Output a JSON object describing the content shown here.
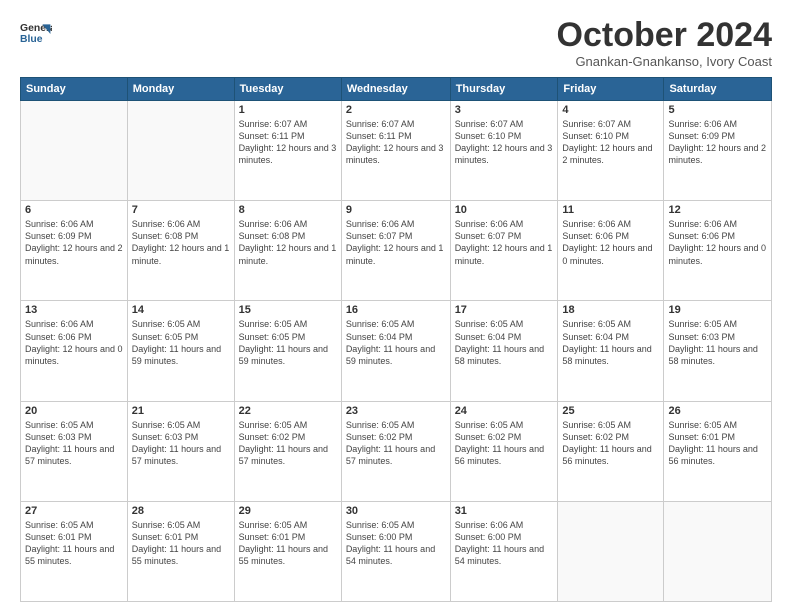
{
  "logo": {
    "line1": "General",
    "line2": "Blue"
  },
  "title": "October 2024",
  "subtitle": "Gnankan-Gnankanso, Ivory Coast",
  "weekdays": [
    "Sunday",
    "Monday",
    "Tuesday",
    "Wednesday",
    "Thursday",
    "Friday",
    "Saturday"
  ],
  "weeks": [
    [
      {
        "day": "",
        "info": ""
      },
      {
        "day": "",
        "info": ""
      },
      {
        "day": "1",
        "info": "Sunrise: 6:07 AM\nSunset: 6:11 PM\nDaylight: 12 hours and 3 minutes."
      },
      {
        "day": "2",
        "info": "Sunrise: 6:07 AM\nSunset: 6:11 PM\nDaylight: 12 hours and 3 minutes."
      },
      {
        "day": "3",
        "info": "Sunrise: 6:07 AM\nSunset: 6:10 PM\nDaylight: 12 hours and 3 minutes."
      },
      {
        "day": "4",
        "info": "Sunrise: 6:07 AM\nSunset: 6:10 PM\nDaylight: 12 hours and 2 minutes."
      },
      {
        "day": "5",
        "info": "Sunrise: 6:06 AM\nSunset: 6:09 PM\nDaylight: 12 hours and 2 minutes."
      }
    ],
    [
      {
        "day": "6",
        "info": "Sunrise: 6:06 AM\nSunset: 6:09 PM\nDaylight: 12 hours and 2 minutes."
      },
      {
        "day": "7",
        "info": "Sunrise: 6:06 AM\nSunset: 6:08 PM\nDaylight: 12 hours and 1 minute."
      },
      {
        "day": "8",
        "info": "Sunrise: 6:06 AM\nSunset: 6:08 PM\nDaylight: 12 hours and 1 minute."
      },
      {
        "day": "9",
        "info": "Sunrise: 6:06 AM\nSunset: 6:07 PM\nDaylight: 12 hours and 1 minute."
      },
      {
        "day": "10",
        "info": "Sunrise: 6:06 AM\nSunset: 6:07 PM\nDaylight: 12 hours and 1 minute."
      },
      {
        "day": "11",
        "info": "Sunrise: 6:06 AM\nSunset: 6:06 PM\nDaylight: 12 hours and 0 minutes."
      },
      {
        "day": "12",
        "info": "Sunrise: 6:06 AM\nSunset: 6:06 PM\nDaylight: 12 hours and 0 minutes."
      }
    ],
    [
      {
        "day": "13",
        "info": "Sunrise: 6:06 AM\nSunset: 6:06 PM\nDaylight: 12 hours and 0 minutes."
      },
      {
        "day": "14",
        "info": "Sunrise: 6:05 AM\nSunset: 6:05 PM\nDaylight: 11 hours and 59 minutes."
      },
      {
        "day": "15",
        "info": "Sunrise: 6:05 AM\nSunset: 6:05 PM\nDaylight: 11 hours and 59 minutes."
      },
      {
        "day": "16",
        "info": "Sunrise: 6:05 AM\nSunset: 6:04 PM\nDaylight: 11 hours and 59 minutes."
      },
      {
        "day": "17",
        "info": "Sunrise: 6:05 AM\nSunset: 6:04 PM\nDaylight: 11 hours and 58 minutes."
      },
      {
        "day": "18",
        "info": "Sunrise: 6:05 AM\nSunset: 6:04 PM\nDaylight: 11 hours and 58 minutes."
      },
      {
        "day": "19",
        "info": "Sunrise: 6:05 AM\nSunset: 6:03 PM\nDaylight: 11 hours and 58 minutes."
      }
    ],
    [
      {
        "day": "20",
        "info": "Sunrise: 6:05 AM\nSunset: 6:03 PM\nDaylight: 11 hours and 57 minutes."
      },
      {
        "day": "21",
        "info": "Sunrise: 6:05 AM\nSunset: 6:03 PM\nDaylight: 11 hours and 57 minutes."
      },
      {
        "day": "22",
        "info": "Sunrise: 6:05 AM\nSunset: 6:02 PM\nDaylight: 11 hours and 57 minutes."
      },
      {
        "day": "23",
        "info": "Sunrise: 6:05 AM\nSunset: 6:02 PM\nDaylight: 11 hours and 57 minutes."
      },
      {
        "day": "24",
        "info": "Sunrise: 6:05 AM\nSunset: 6:02 PM\nDaylight: 11 hours and 56 minutes."
      },
      {
        "day": "25",
        "info": "Sunrise: 6:05 AM\nSunset: 6:02 PM\nDaylight: 11 hours and 56 minutes."
      },
      {
        "day": "26",
        "info": "Sunrise: 6:05 AM\nSunset: 6:01 PM\nDaylight: 11 hours and 56 minutes."
      }
    ],
    [
      {
        "day": "27",
        "info": "Sunrise: 6:05 AM\nSunset: 6:01 PM\nDaylight: 11 hours and 55 minutes."
      },
      {
        "day": "28",
        "info": "Sunrise: 6:05 AM\nSunset: 6:01 PM\nDaylight: 11 hours and 55 minutes."
      },
      {
        "day": "29",
        "info": "Sunrise: 6:05 AM\nSunset: 6:01 PM\nDaylight: 11 hours and 55 minutes."
      },
      {
        "day": "30",
        "info": "Sunrise: 6:05 AM\nSunset: 6:00 PM\nDaylight: 11 hours and 54 minutes."
      },
      {
        "day": "31",
        "info": "Sunrise: 6:06 AM\nSunset: 6:00 PM\nDaylight: 11 hours and 54 minutes."
      },
      {
        "day": "",
        "info": ""
      },
      {
        "day": "",
        "info": ""
      }
    ]
  ]
}
